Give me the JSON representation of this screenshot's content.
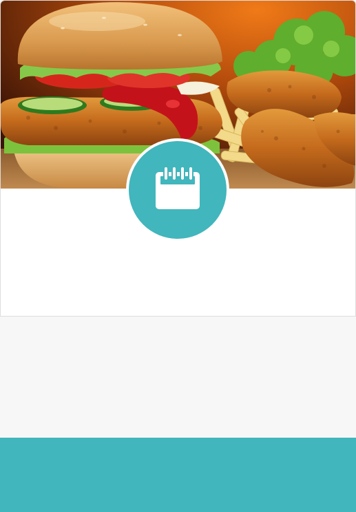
{
  "card": {
    "hero_image": "fast-food-burger-nuggets-fries-photo",
    "badge_icon": "calendar-icon"
  },
  "colors": {
    "accent": "#41b6bc",
    "page_background": "#f7f7f7",
    "card_background": "#ffffff",
    "card_border": "#dddddd"
  }
}
